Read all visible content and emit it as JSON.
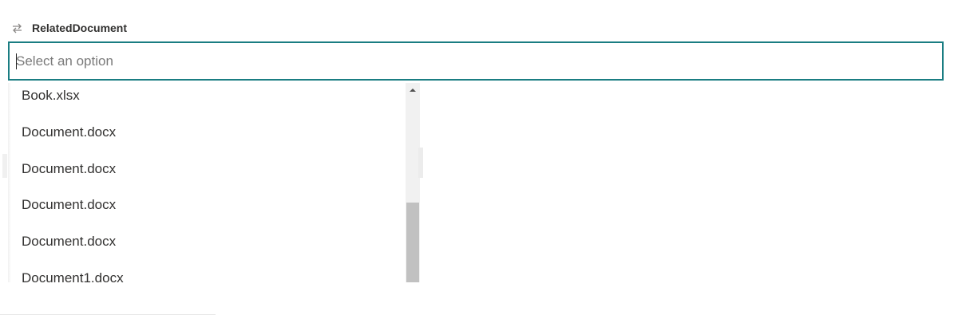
{
  "field": {
    "label": "RelatedDocument",
    "icon": "sync-arrows-icon"
  },
  "combo": {
    "placeholder": "Select an option",
    "value": ""
  },
  "dropdown": {
    "options": [
      {
        "label": "Book.xlsx"
      },
      {
        "label": "Document.docx"
      },
      {
        "label": "Document.docx"
      },
      {
        "label": "Document.docx"
      },
      {
        "label": "Document.docx"
      },
      {
        "label": "Document1.docx"
      }
    ],
    "scroll_position": 1.0
  },
  "colors": {
    "focus_border": "#1a7d82",
    "text": "#323130",
    "placeholder": "#7a7a7a",
    "scroll_track": "#f1f1f1",
    "scroll_thumb": "#c1c1c1"
  }
}
